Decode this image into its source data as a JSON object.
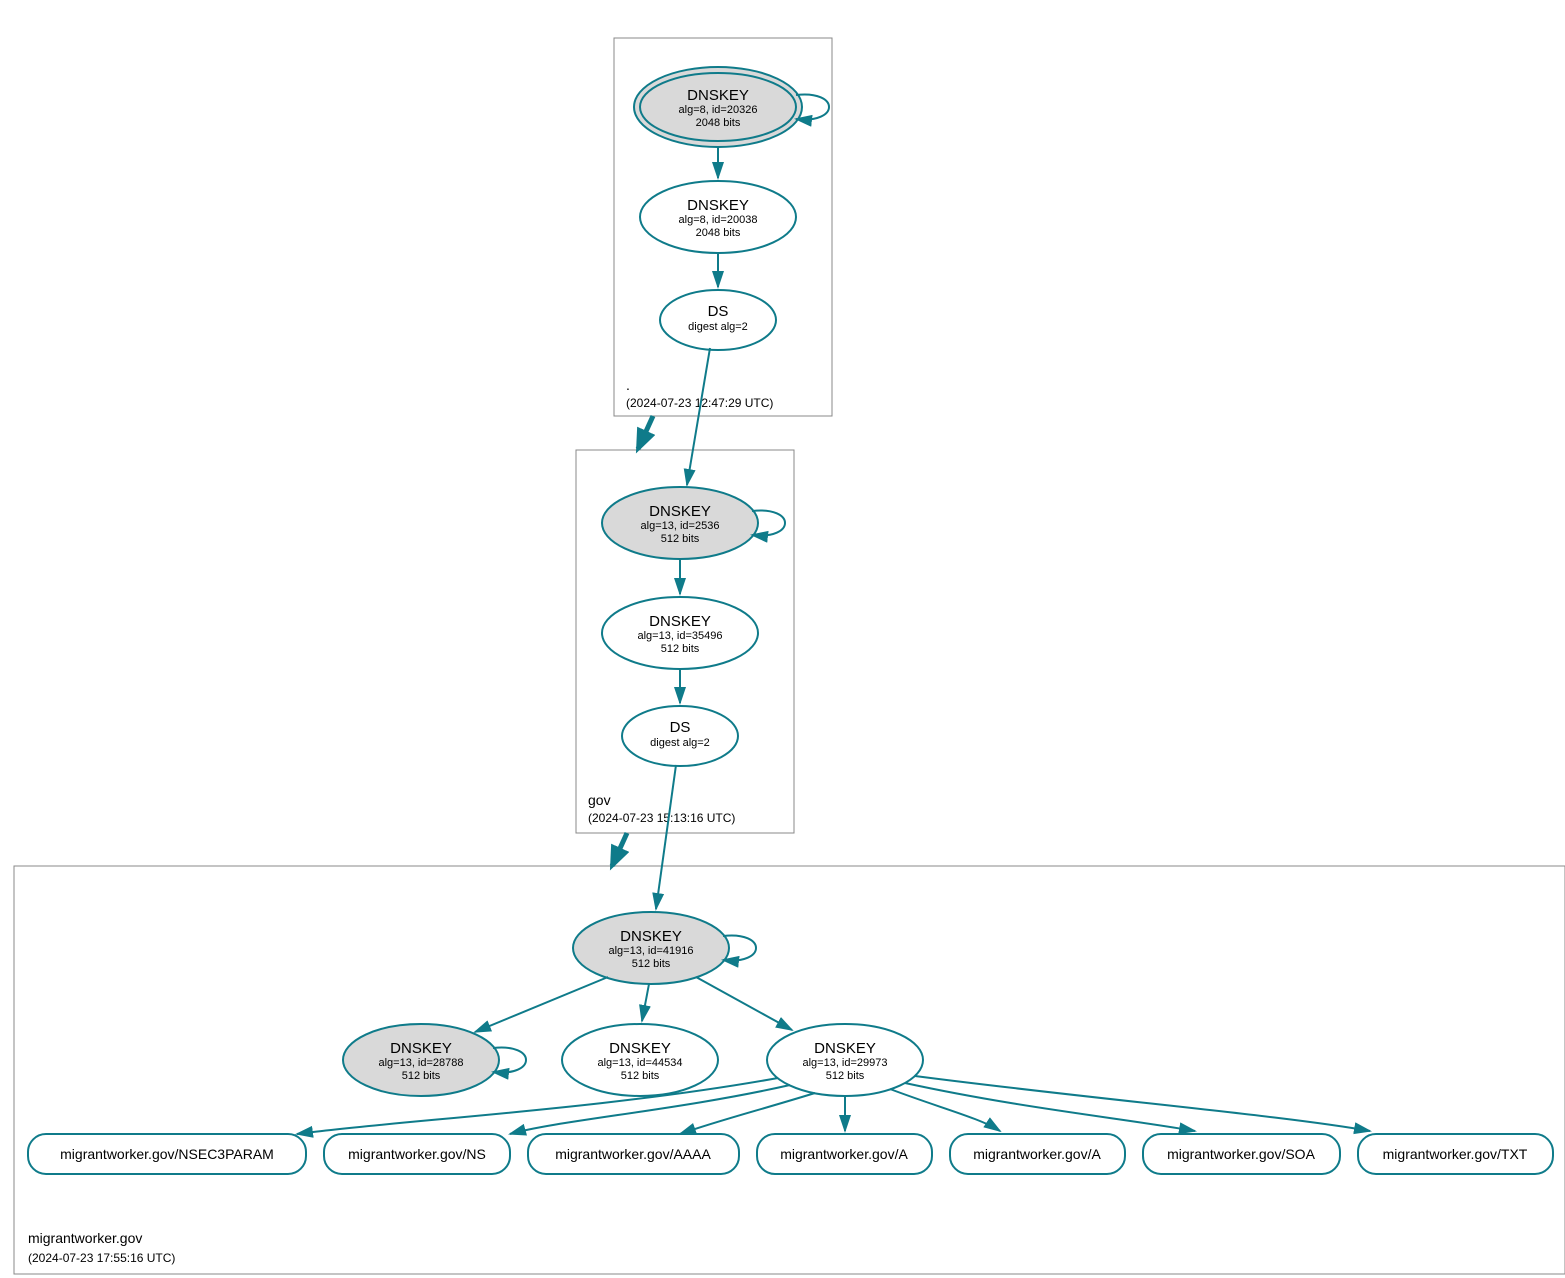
{
  "zones": {
    "root": {
      "label": ".",
      "timestamp": "(2024-07-23 12:47:29 UTC)"
    },
    "gov": {
      "label": "gov",
      "timestamp": "(2024-07-23 15:13:16 UTC)"
    },
    "mw": {
      "label": "migrantworker.gov",
      "timestamp": "(2024-07-23 17:55:16 UTC)"
    }
  },
  "nodes": {
    "root_ksk": {
      "title": "DNSKEY",
      "line1": "alg=8, id=20326",
      "line2": "2048 bits"
    },
    "root_zsk": {
      "title": "DNSKEY",
      "line1": "alg=8, id=20038",
      "line2": "2048 bits"
    },
    "root_ds": {
      "title": "DS",
      "line1": "digest alg=2"
    },
    "gov_ksk": {
      "title": "DNSKEY",
      "line1": "alg=13, id=2536",
      "line2": "512 bits"
    },
    "gov_zsk": {
      "title": "DNSKEY",
      "line1": "alg=13, id=35496",
      "line2": "512 bits"
    },
    "gov_ds": {
      "title": "DS",
      "line1": "digest alg=2"
    },
    "mw_ksk": {
      "title": "DNSKEY",
      "line1": "alg=13, id=41916",
      "line2": "512 bits"
    },
    "mw_key1": {
      "title": "DNSKEY",
      "line1": "alg=13, id=28788",
      "line2": "512 bits"
    },
    "mw_key2": {
      "title": "DNSKEY",
      "line1": "alg=13, id=44534",
      "line2": "512 bits"
    },
    "mw_key3": {
      "title": "DNSKEY",
      "line1": "alg=13, id=29973",
      "line2": "512 bits"
    }
  },
  "records": {
    "r1": "migrantworker.gov/NSEC3PARAM",
    "r2": "migrantworker.gov/NS",
    "r3": "migrantworker.gov/AAAA",
    "r4": "migrantworker.gov/A",
    "r5": "migrantworker.gov/A",
    "r6": "migrantworker.gov/SOA",
    "r7": "migrantworker.gov/TXT"
  }
}
